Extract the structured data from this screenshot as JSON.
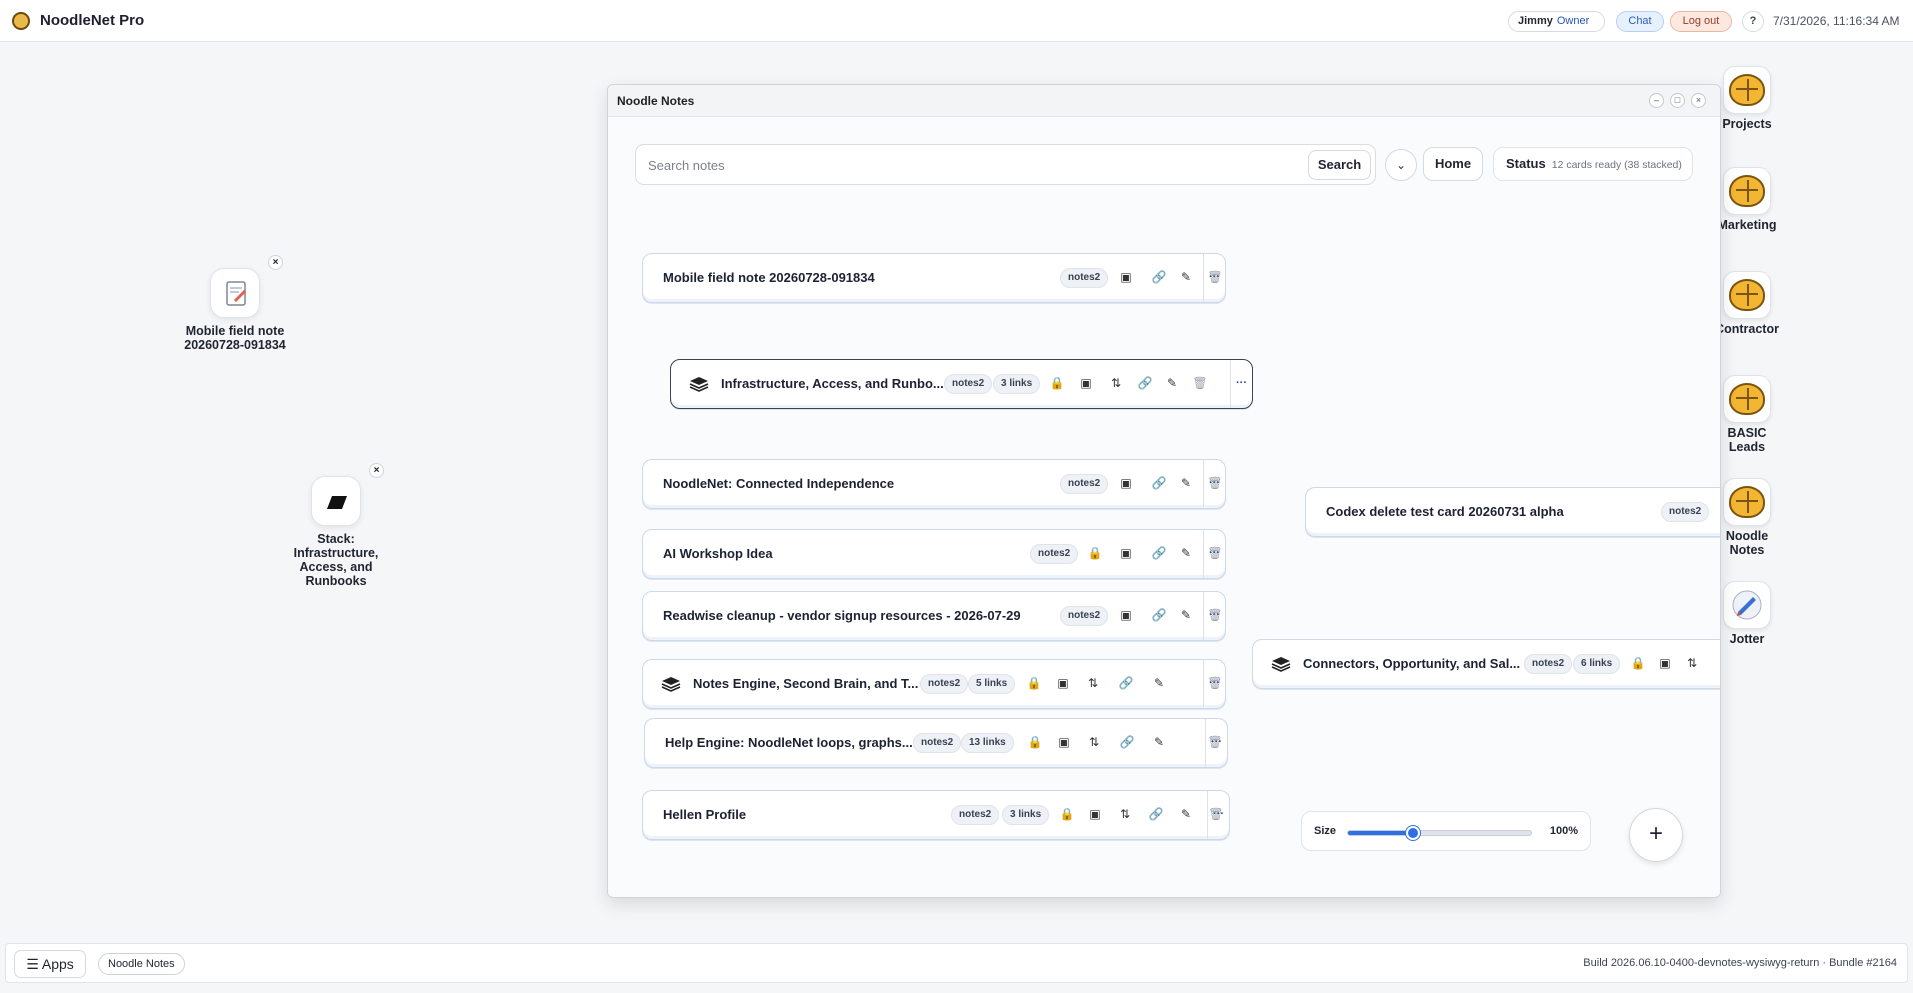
{
  "app": {
    "title": "NoodleNet Pro"
  },
  "header": {
    "user_name": "Jimmy",
    "user_role": "Owner",
    "chat_label": "Chat",
    "logout_label": "Log out",
    "help_label": "?",
    "datetime": "7/31/2026, 11:16:34 AM"
  },
  "desktop": {
    "icons": [
      {
        "label": "Mobile field note 20260728-091834",
        "close": "×",
        "icon": "note-icon"
      },
      {
        "label": "Stack: Infrastructure, Access, and Runbooks",
        "close": "×",
        "icon": "stack-icon"
      }
    ]
  },
  "dock": {
    "items": [
      {
        "label": "Projects",
        "icon": "brain-icon"
      },
      {
        "label": "Marketing",
        "icon": "brain-icon"
      },
      {
        "label": "Contractor",
        "icon": "brain-icon"
      },
      {
        "label": "BASIC Leads",
        "icon": "brain-icon"
      },
      {
        "label": "Noodle Notes",
        "icon": "brain-icon"
      },
      {
        "label": "Jotter",
        "icon": "jotter-icon"
      }
    ]
  },
  "window": {
    "title": "Noodle Notes",
    "controls": {
      "minimize": "–",
      "maximize": "□",
      "close": "×"
    },
    "search": {
      "placeholder": "Search notes",
      "value": "",
      "button": "Search"
    },
    "chevron": "⌄",
    "home_label": "Home",
    "status": {
      "label": "Status",
      "text": "12 cards ready (38 stacked)"
    },
    "cards": [
      {
        "title": "Mobile field note 20260728-091834",
        "tags": [
          "notes2"
        ],
        "stack": false,
        "locked": false,
        "sort": false
      },
      {
        "title": "Infrastructure, Access, and Runbo...",
        "tags": [
          "notes2",
          "3 links"
        ],
        "stack": true,
        "locked": true,
        "sort": true,
        "selected": true
      },
      {
        "title": "NoodleNet: Connected Independence",
        "tags": [
          "notes2"
        ],
        "stack": false,
        "locked": false,
        "sort": false
      },
      {
        "title": "AI Workshop Idea",
        "tags": [
          "notes2"
        ],
        "stack": false,
        "locked": true,
        "sort": false
      },
      {
        "title": "Readwise cleanup - vendor signup resources - 2026-07-29",
        "tags": [
          "notes2"
        ],
        "stack": false,
        "locked": false,
        "sort": false
      },
      {
        "title": "Notes Engine, Second Brain, and T...",
        "tags": [
          "notes2",
          "5 links"
        ],
        "stack": true,
        "locked": true,
        "sort": true
      },
      {
        "title": "Help Engine: NoodleNet loops, graphs...",
        "tags": [
          "notes2",
          "13 links"
        ],
        "stack": false,
        "locked": true,
        "sort": true
      },
      {
        "title": "Hellen Profile",
        "tags": [
          "notes2",
          "3 links"
        ],
        "stack": false,
        "locked": true,
        "sort": true
      },
      {
        "title": "Codex delete test card 20260731 alpha",
        "tags": [
          "notes2"
        ],
        "stack": false
      },
      {
        "title": "Connectors, Opportunity, and Sal...",
        "tags": [
          "notes2",
          "6 links"
        ],
        "stack": true,
        "locked": true,
        "sort": true
      }
    ],
    "more_label": "···",
    "size": {
      "label": "Size",
      "value_text": "100%",
      "level": 0.35
    },
    "add_label": "+"
  },
  "taskbar": {
    "apps_label": "☰ Apps",
    "open_window": "Noodle Notes",
    "build": "Build 2026.06.10-0400-devnotes-wysiwyg-return · Bundle #2164"
  },
  "colors": {
    "accent": "#2f6fe4",
    "lock": "#d58a00",
    "brain": "#f2b632"
  }
}
